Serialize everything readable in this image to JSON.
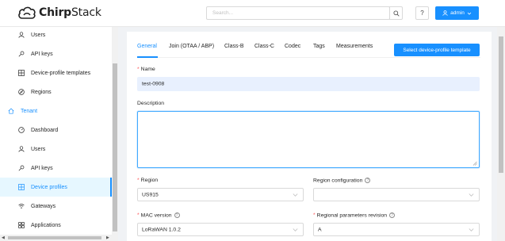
{
  "header": {
    "logo_text_bold": "Chirp",
    "logo_text_rest": "Stack",
    "search_placeholder": "Search...",
    "help_label": "?",
    "user_label": "admin",
    "accent": "#1890ff"
  },
  "sidebar": {
    "items": [
      {
        "label": "Users",
        "icon": "user-icon"
      },
      {
        "label": "API keys",
        "icon": "key-icon"
      },
      {
        "label": "Device-profile templates",
        "icon": "grid-icon"
      },
      {
        "label": "Regions",
        "icon": "compass-icon"
      },
      {
        "label": "Tenant",
        "icon": "home-icon"
      },
      {
        "label": "Dashboard",
        "icon": "dashboard-icon"
      },
      {
        "label": "Users",
        "icon": "user-icon"
      },
      {
        "label": "API keys",
        "icon": "key-icon"
      },
      {
        "label": "Device profiles",
        "icon": "grid-icon"
      },
      {
        "label": "Gateways",
        "icon": "wifi-icon"
      },
      {
        "label": "Applications",
        "icon": "appstore-icon"
      }
    ]
  },
  "tabs": [
    {
      "label": "General"
    },
    {
      "label": "Join (OTAA / ABP)"
    },
    {
      "label": "Class-B"
    },
    {
      "label": "Class-C"
    },
    {
      "label": "Codec"
    },
    {
      "label": "Tags"
    },
    {
      "label": "Measurements"
    }
  ],
  "template_button": "Select device-profile template",
  "form": {
    "name_label": "Name",
    "name_value": "test-0908",
    "description_label": "Description",
    "description_value": "",
    "region_label": "Region",
    "region_value": "US915",
    "region_config_label": "Region configuration",
    "region_config_value": "",
    "mac_label": "MAC version",
    "mac_value": "LoRaWAN 1.0.2",
    "regional_params_label": "Regional parameters revision",
    "regional_params_value": "A"
  }
}
